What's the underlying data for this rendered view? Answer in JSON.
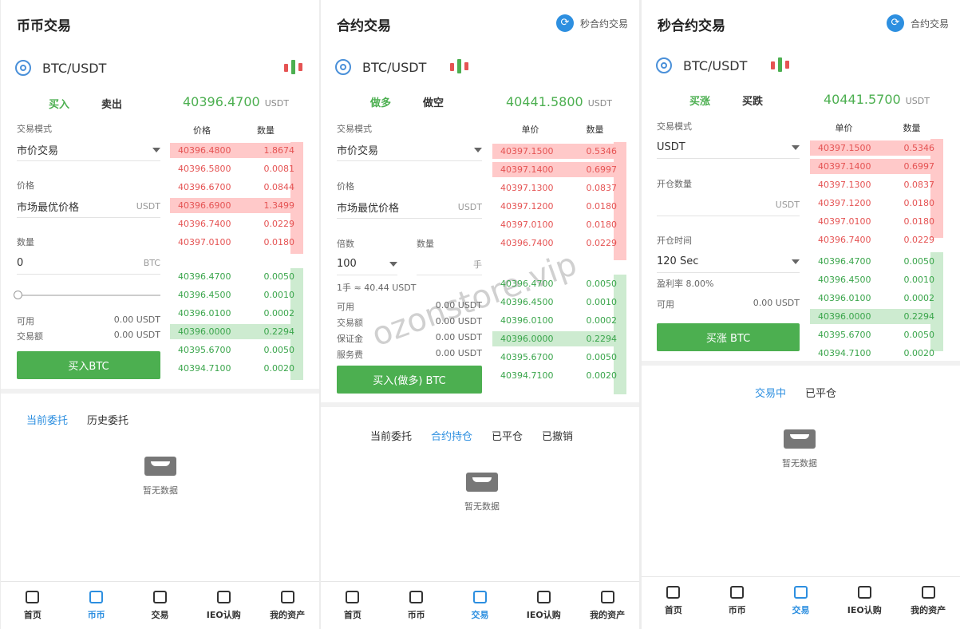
{
  "colors": {
    "green": "#4caf50",
    "red": "#e55353",
    "blue": "#2d8fe0"
  },
  "watermark": "ozonstore.vip",
  "empty_text": "暂无数据",
  "nav": [
    "首页",
    "币币",
    "交易",
    "IEO认购",
    "我的资产"
  ],
  "p1": {
    "title": "币币交易",
    "pair": "BTC/USDT",
    "tab_buy": "买入",
    "tab_sell": "卖出",
    "price": "40396.4700",
    "price_unit": "USDT",
    "mode_label": "交易模式",
    "mode_value": "市价交易",
    "price_label": "价格",
    "price_value": "市场最优价格",
    "price_unit2": "USDT",
    "qty_label": "数量",
    "qty_value": "0",
    "qty_unit": "BTC",
    "avail_label": "可用",
    "avail_value": "0.00 USDT",
    "amount_label": "交易额",
    "amount_value": "0.00 USDT",
    "button": "买入BTC",
    "ob_price": "价格",
    "ob_qty": "数量",
    "asks": [
      [
        "40396.4800",
        "1.8674"
      ],
      [
        "40396.5800",
        "0.0081"
      ],
      [
        "40396.6700",
        "0.0844"
      ],
      [
        "40396.6900",
        "1.3499"
      ],
      [
        "40396.7400",
        "0.0229"
      ],
      [
        "40397.0100",
        "0.0180"
      ]
    ],
    "bids": [
      [
        "40396.4700",
        "0.0050"
      ],
      [
        "40396.4500",
        "0.0010"
      ],
      [
        "40396.0100",
        "0.0002"
      ],
      [
        "40396.0000",
        "0.2294"
      ],
      [
        "40395.6700",
        "0.0050"
      ],
      [
        "40394.7100",
        "0.0020"
      ]
    ],
    "order_tabs": [
      "当前委托",
      "历史委托"
    ]
  },
  "p2": {
    "title": "合约交易",
    "link": "秒合约交易",
    "pair": "BTC/USDT",
    "tab_buy": "做多",
    "tab_sell": "做空",
    "price": "40441.5800",
    "price_unit": "USDT",
    "mode_label": "交易模式",
    "mode_value": "市价交易",
    "price_label": "价格",
    "price_value": "市场最优价格",
    "price_unit2": "USDT",
    "lev_label": "倍数",
    "lev_value": "100",
    "qty_label": "数量",
    "qty_unit": "手",
    "lot_note": "1手 ≈ 40.44 USDT",
    "avail_label": "可用",
    "avail_value": "0.00 USDT",
    "amount_label": "交易额",
    "amount_value": "0.00 USDT",
    "margin_label": "保证金",
    "margin_value": "0.00 USDT",
    "fee_label": "服务费",
    "fee_value": "0.00 USDT",
    "button": "买入(做多) BTC",
    "ob_price": "单价",
    "ob_qty": "数量",
    "asks": [
      [
        "40397.1500",
        "0.5346"
      ],
      [
        "40397.1400",
        "0.6997"
      ],
      [
        "40397.1300",
        "0.0837"
      ],
      [
        "40397.1200",
        "0.0180"
      ],
      [
        "40397.0100",
        "0.0180"
      ],
      [
        "40396.7400",
        "0.0229"
      ]
    ],
    "bids": [
      [
        "40396.4700",
        "0.0050"
      ],
      [
        "40396.4500",
        "0.0010"
      ],
      [
        "40396.0100",
        "0.0002"
      ],
      [
        "40396.0000",
        "0.2294"
      ],
      [
        "40395.6700",
        "0.0050"
      ],
      [
        "40394.7100",
        "0.0020"
      ]
    ],
    "order_tabs": [
      "当前委托",
      "合约持仓",
      "已平仓",
      "已撤销"
    ]
  },
  "p3": {
    "title": "秒合约交易",
    "link": "合约交易",
    "pair": "BTC/USDT",
    "tab_buy": "买涨",
    "tab_sell": "买跌",
    "price": "40441.5700",
    "price_unit": "USDT",
    "mode_label": "交易模式",
    "mode_value": "USDT",
    "qty_label": "开仓数量",
    "qty_unit": "USDT",
    "time_label": "开仓时间",
    "time_value": "120 Sec",
    "profit": "盈利率 8.00%",
    "avail_label": "可用",
    "avail_value": "0.00  USDT",
    "button": "买涨 BTC",
    "ob_price": "单价",
    "ob_qty": "数量",
    "asks": [
      [
        "40397.1500",
        "0.5346"
      ],
      [
        "40397.1400",
        "0.6997"
      ],
      [
        "40397.1300",
        "0.0837"
      ],
      [
        "40397.1200",
        "0.0180"
      ],
      [
        "40397.0100",
        "0.0180"
      ],
      [
        "40396.7400",
        "0.0229"
      ]
    ],
    "bids": [
      [
        "40396.4700",
        "0.0050"
      ],
      [
        "40396.4500",
        "0.0010"
      ],
      [
        "40396.0100",
        "0.0002"
      ],
      [
        "40396.0000",
        "0.2294"
      ],
      [
        "40395.6700",
        "0.0050"
      ],
      [
        "40394.7100",
        "0.0020"
      ]
    ],
    "order_tabs": [
      "交易中",
      "已平仓"
    ]
  }
}
